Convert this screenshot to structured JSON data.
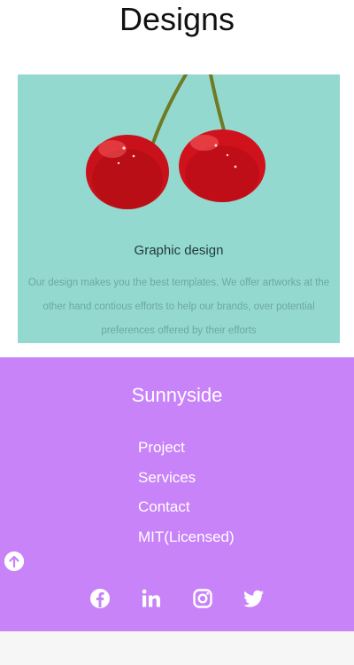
{
  "header": {
    "title": "Designs"
  },
  "card": {
    "title": "Graphic design",
    "description": "Our design makes you the best templates. We offer artworks at the other hand contious efforts to help our brands, over potential preferences offered by their efforts",
    "image_background": "#94d9cf"
  },
  "footer": {
    "brand": "Sunnyside",
    "links": [
      "Project",
      "Services",
      "Contact",
      "MIT(Licensed)"
    ],
    "background": "#c883f8",
    "scroll_top_icon": "arrow-up-circle-icon",
    "social": [
      "facebook-icon",
      "linkedin-icon",
      "instagram-icon",
      "twitter-icon"
    ]
  }
}
